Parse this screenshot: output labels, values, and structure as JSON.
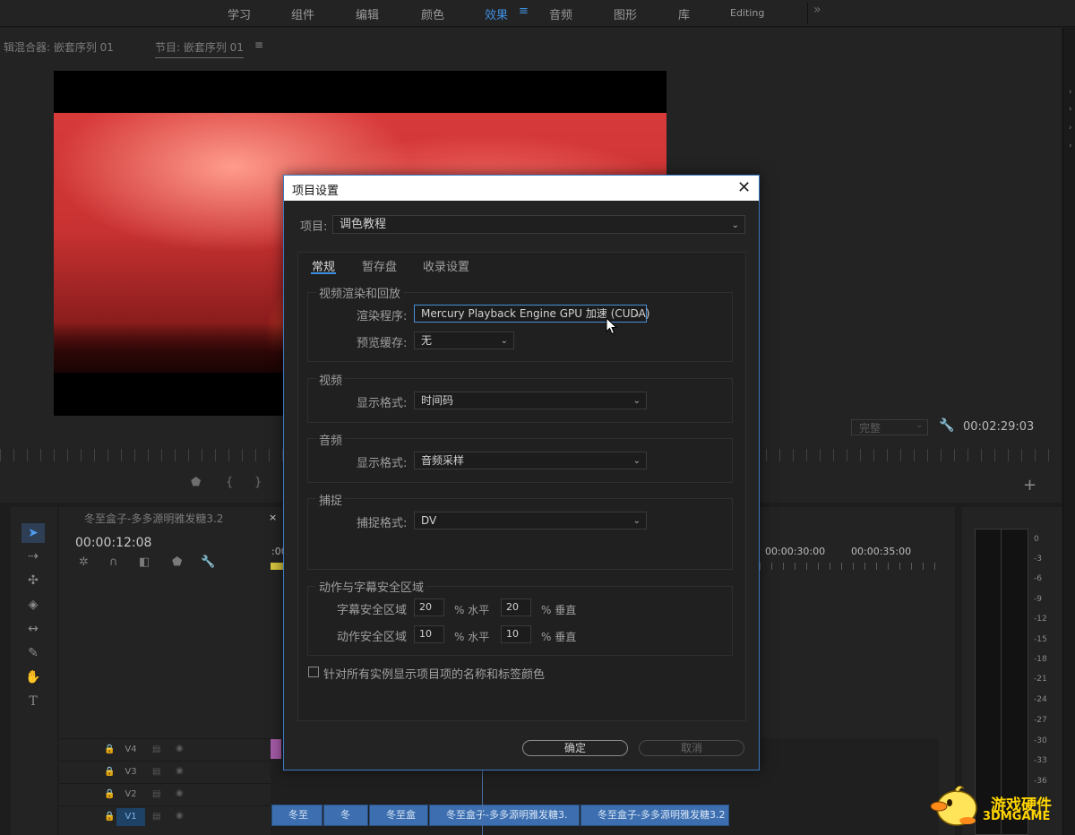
{
  "workspace_tabs": [
    {
      "label": "学习"
    },
    {
      "label": "组件"
    },
    {
      "label": "编辑"
    },
    {
      "label": "颜色"
    },
    {
      "label": "效果"
    },
    {
      "label": "音频"
    },
    {
      "label": "图形"
    },
    {
      "label": "库"
    },
    {
      "label": "Editing"
    }
  ],
  "workspace_active": "效果",
  "monitor": {
    "tab_left": "辑混合器: 嵌套序列 01",
    "tab_program": "节目: 嵌套序列 01",
    "quality": "完整",
    "timecode": "00:02:29:03"
  },
  "timeline": {
    "sequence_name": "冬至盒子-多多源明雅发糖3.2",
    "close_symbol": "×",
    "timecode": "00:00:12:08",
    "ruler_labels": [
      ":00",
      "00:00:30:00",
      "00:00:35:00"
    ],
    "tracks": [
      {
        "label": "V4",
        "active": false
      },
      {
        "label": "V3",
        "active": false
      },
      {
        "label": "V2",
        "active": false
      },
      {
        "label": "V1",
        "active": true
      }
    ],
    "clips": [
      {
        "label": "冬至"
      },
      {
        "label": "冬"
      },
      {
        "label": "冬至盒"
      },
      {
        "label": "冬至盒子-多多源明雅发糖3."
      },
      {
        "label": "冬至盒子-多多源明雅发糖3.2"
      }
    ]
  },
  "meter": {
    "labels": [
      "0",
      "-3",
      "-6",
      "-9",
      "-12",
      "-15",
      "-18",
      "-21",
      "-24",
      "-27",
      "-30",
      "-33",
      "-36"
    ]
  },
  "dialog": {
    "title": "项目设置",
    "project_label": "项目:",
    "project_value": "调色教程",
    "tabs": [
      "常规",
      "暂存盘",
      "收录设置"
    ],
    "active_tab": "常规",
    "render_group": {
      "title": "视频渲染和回放",
      "renderer_label": "渲染程序:",
      "renderer_value": "Mercury Playback Engine GPU 加速 (CUDA)",
      "preview_cache_label": "预览缓存:",
      "preview_cache_value": "无"
    },
    "video_group": {
      "title": "视频",
      "format_label": "显示格式:",
      "format_value": "时间码"
    },
    "audio_group": {
      "title": "音频",
      "format_label": "显示格式:",
      "format_value": "音频采样"
    },
    "capture_group": {
      "title": "捕捉",
      "format_label": "捕捉格式:",
      "format_value": "DV"
    },
    "safe_group": {
      "title": "动作与字幕安全区域",
      "title_safe_label": "字幕安全区域",
      "title_safe_h": "20",
      "title_safe_v": "20",
      "action_safe_label": "动作安全区域",
      "action_safe_h": "10",
      "action_safe_v": "10",
      "unit_h": "% 水平",
      "unit_v": "% 垂直"
    },
    "checkbox_label": "针对所有实例显示项目项的名称和标签颜色",
    "checkbox_checked": false,
    "ok_label": "确定",
    "cancel_label": "取消"
  },
  "watermark": {
    "text_cn": "游戏硬件",
    "text_en": "3DMGAME"
  },
  "colors": {
    "accent": "#3f8fe0",
    "clip_blue": "#3d6fb0",
    "clip_pink": "#a35aa5",
    "watermark": "#ffd400"
  }
}
